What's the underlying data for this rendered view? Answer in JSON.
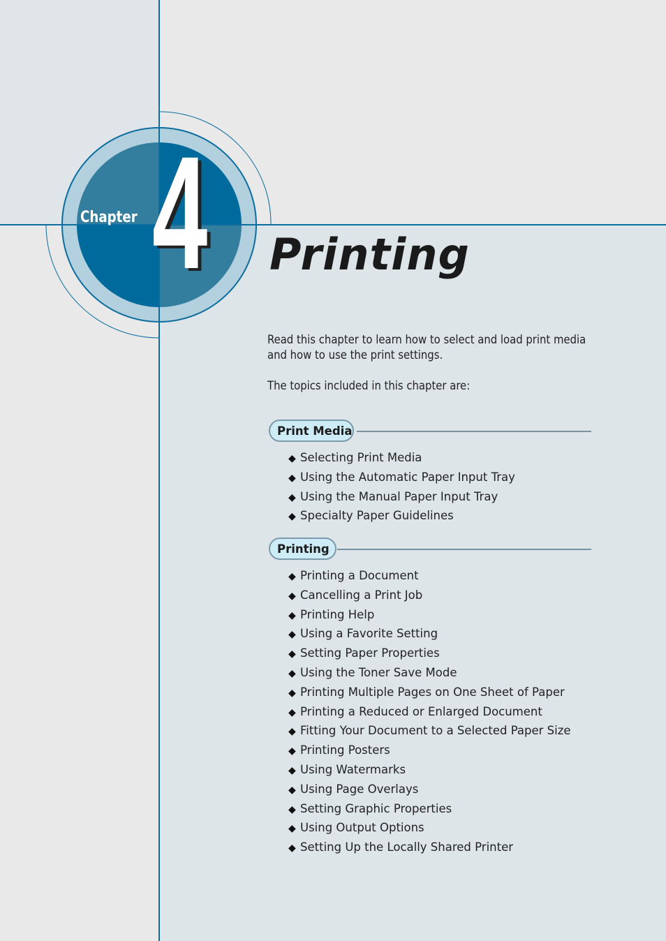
{
  "chapter": {
    "label": "Chapter",
    "number": "4",
    "title": "Printing"
  },
  "colors": {
    "accent_blue": "#0b6d9e",
    "circle_dark": "#006a9d",
    "circle_mid": "#337d9f",
    "ring_light": "#b2d0de",
    "pill_fill": "#cdecf6"
  },
  "intro": {
    "paragraph1": "Read this chapter to learn how to select and load print media and how to use the print settings.",
    "paragraph2": "The topics included in this chapter are:"
  },
  "sections": [
    {
      "heading": "Print Media",
      "bullet_icon": "diamond-bullet",
      "items": [
        "Selecting Print Media",
        "Using the Automatic Paper Input Tray",
        "Using the Manual Paper Input Tray",
        "Specialty Paper Guidelines"
      ]
    },
    {
      "heading": "Printing",
      "bullet_icon": "diamond-bullet",
      "items": [
        "Printing a Document",
        "Cancelling a Print Job",
        "Printing Help",
        "Using a Favorite Setting",
        "Setting Paper Properties",
        "Using the Toner Save Mode",
        "Printing Multiple Pages on One Sheet of Paper",
        "Printing a Reduced or Enlarged Document",
        "Fitting Your Document to a Selected Paper Size",
        "Printing Posters",
        "Using Watermarks",
        "Using Page Overlays",
        "Setting Graphic Properties",
        "Using Output Options",
        "Setting Up the Locally Shared Printer"
      ]
    }
  ]
}
